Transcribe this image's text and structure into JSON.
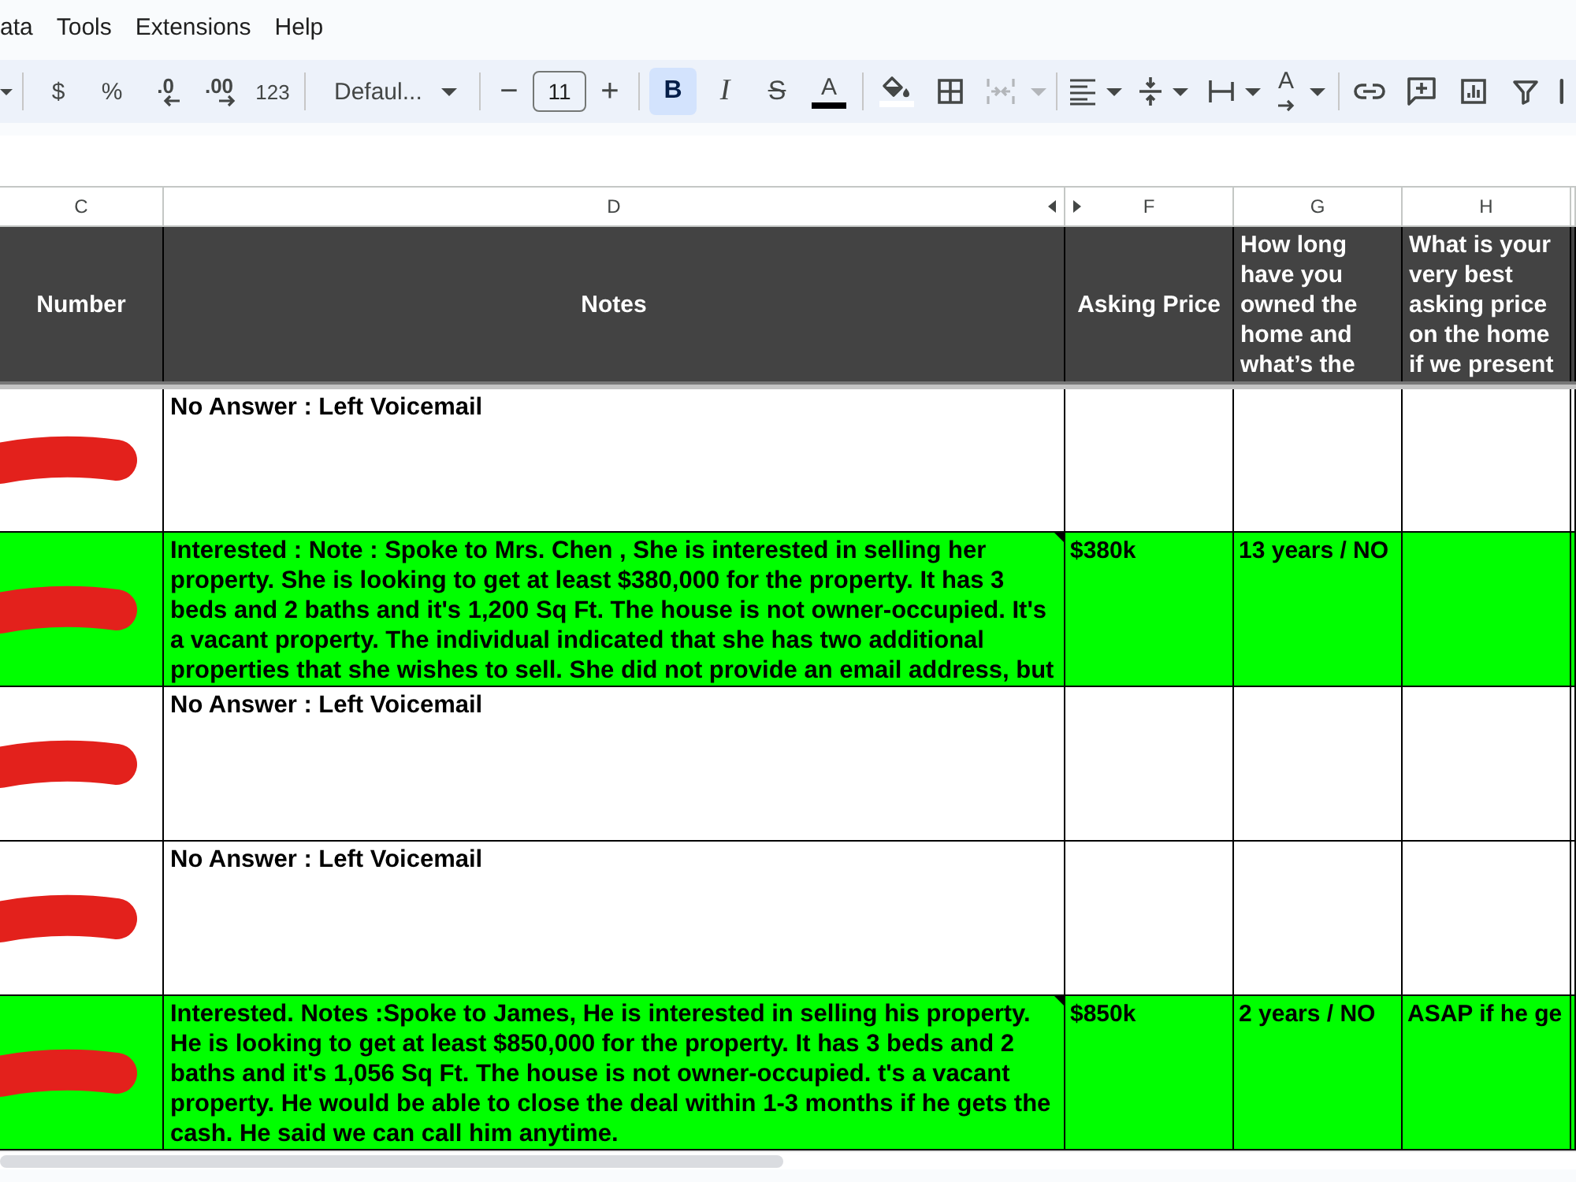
{
  "menu_bar": {
    "items": [
      "ata",
      "Tools",
      "Extensions",
      "Help"
    ]
  },
  "toolbar": {
    "groups": [
      {
        "items": [
          {
            "kind": "dropdown_caret"
          }
        ]
      },
      {
        "items": [
          {
            "kind": "currency",
            "label": "$"
          },
          {
            "kind": "percent",
            "label": "%"
          },
          {
            "kind": "decimal_less",
            "label": ".0"
          },
          {
            "kind": "decimal_more",
            "label": ".00"
          },
          {
            "kind": "number_format",
            "label": "123"
          }
        ]
      },
      {
        "items": [
          {
            "kind": "font",
            "label": "Defaul..."
          }
        ]
      },
      {
        "items": [
          {
            "kind": "size_down",
            "label": "−"
          },
          {
            "kind": "size",
            "value": "11"
          },
          {
            "kind": "size_up",
            "label": "+"
          }
        ]
      },
      {
        "items": [
          {
            "kind": "bold",
            "label": "B",
            "on": true
          },
          {
            "kind": "italic",
            "label": "I",
            "on": false
          },
          {
            "kind": "strike",
            "label": "S",
            "on": false
          },
          {
            "kind": "text_color",
            "label": "A",
            "color": "#000000"
          }
        ]
      },
      {
        "items": [
          {
            "kind": "fill_color",
            "color": "#ffffff",
            "disabled": false
          },
          {
            "kind": "borders",
            "disabled": false
          },
          {
            "kind": "merge",
            "disabled": true
          }
        ]
      },
      {
        "items": [
          {
            "kind": "align"
          },
          {
            "kind": "valign"
          },
          {
            "kind": "wrap"
          },
          {
            "kind": "rotate",
            "label": "A"
          }
        ]
      },
      {
        "items": [
          {
            "kind": "link"
          },
          {
            "kind": "comment"
          },
          {
            "kind": "chart"
          },
          {
            "kind": "filter"
          },
          {
            "kind": "more"
          }
        ]
      }
    ]
  },
  "sheet": {
    "columns": [
      {
        "letter": "C",
        "after_hidden": false
      },
      {
        "letter": "D",
        "after_hidden": false
      },
      {
        "letter": "F",
        "after_hidden": true
      },
      {
        "letter": "G",
        "after_hidden": false
      },
      {
        "letter": "H",
        "after_hidden": false
      }
    ],
    "header_row": [
      {
        "kind": "label",
        "text": "Number"
      },
      {
        "kind": "label",
        "text": "Notes"
      },
      {
        "kind": "label",
        "text": "Asking Price"
      },
      {
        "kind": "question",
        "text": "How long have you owned the home and what’s the"
      },
      {
        "kind": "question",
        "text": "What is your very best asking price on the home if we present"
      }
    ],
    "rows": [
      {
        "redacted": true,
        "highlighted": false,
        "has_note": false,
        "notes": "No Answer : Left Voicemail"
      },
      {
        "redacted": true,
        "highlighted": true,
        "has_note": true,
        "notes": "Interested : Note : Spoke to Mrs. Chen , She is interested in selling her\nproperty. She is looking to get at least $380,000 for the property. It has 3\nbeds and 2 baths and it's 1,200 Sq Ft. The house is not owner-occupied. It's\na vacant property. The individual indicated that she has two additional\nproperties that she wishes to sell. She did not provide an email address, but",
        "asking_price": "$380k",
        "years_owned": "13 years / NO"
      },
      {
        "redacted": true,
        "highlighted": false,
        "has_note": false,
        "notes": "No Answer : Left Voicemail"
      },
      {
        "redacted": true,
        "highlighted": false,
        "has_note": false,
        "notes": "No Answer : Left Voicemail"
      },
      {
        "redacted": true,
        "highlighted": true,
        "has_note": true,
        "notes": "Interested. Notes :Spoke to James, He is interested in selling his property.\nHe is looking to get at least $850,000 for the property. It has 3 beds and 2\nbaths and it's 1,056 Sq Ft. The house is not owner-occupied. t's a vacant\nproperty. He would be able to close the deal within 1-3 months if he gets the\ncash. He said we can call him anytime.",
        "asking_price": "$850k",
        "years_owned": "2 years / NO",
        "best_price": "ASAP if he ge"
      }
    ]
  }
}
